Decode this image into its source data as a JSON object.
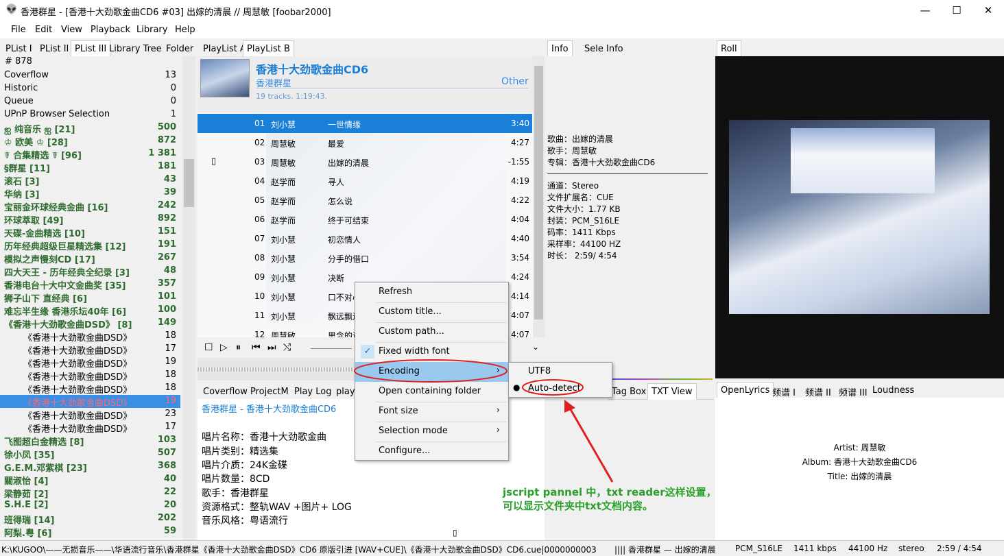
{
  "window": {
    "title": "香港群星 - [香港十大劲歌金曲CD6 #03] 出嫁的清晨 // 周慧敏  [foobar2000]",
    "minimize": "—",
    "maximize": "☐",
    "close": "✕"
  },
  "menu": [
    "File",
    "Edit",
    "View",
    "Playback",
    "Library",
    "Help"
  ],
  "left_tabs": [
    "PList I",
    "PList II",
    "PList III",
    "Library Tree",
    "Folder"
  ],
  "left_count": "# 878",
  "left_list": [
    {
      "name": "Coverflow",
      "count": "13",
      "type": "plain"
    },
    {
      "name": "Historic",
      "count": "0",
      "type": "plain"
    },
    {
      "name": "Queue",
      "count": "0",
      "type": "plain"
    },
    {
      "name": "UPnP Browser Selection",
      "count": "1",
      "type": "plain"
    },
    {
      "name": "ஐ 纯音乐 ஐ [21]",
      "count": "500",
      "type": "grp"
    },
    {
      "name": "♔ 欧美 ♔ [28]",
      "count": "872",
      "type": "grp"
    },
    {
      "name": "☤ 合集精选 ☤ [96]",
      "count": "1 381",
      "type": "grp"
    },
    {
      "name": "§群星 [11]",
      "count": "181",
      "type": "grp"
    },
    {
      "name": "滚石 [3]",
      "count": "43",
      "type": "grp"
    },
    {
      "name": "华纳 [3]",
      "count": "39",
      "type": "grp"
    },
    {
      "name": "宝丽金环球经典金曲 [16]",
      "count": "242",
      "type": "grp"
    },
    {
      "name": "环球萃取 [49]",
      "count": "892",
      "type": "grp"
    },
    {
      "name": "天碟-金曲精选 [10]",
      "count": "151",
      "type": "grp"
    },
    {
      "name": "历年经典超级巨星精选集 [12]",
      "count": "191",
      "type": "grp"
    },
    {
      "name": "模拟之声慢刻CD [17]",
      "count": "267",
      "type": "grp"
    },
    {
      "name": "四大天王 - 历年经典全纪录 [3]",
      "count": "48",
      "type": "grp"
    },
    {
      "name": "香港电台十大中文金曲奖 [35]",
      "count": "357",
      "type": "grp"
    },
    {
      "name": "狮子山下 直经典 [6]",
      "count": "101",
      "type": "grp"
    },
    {
      "name": "难忘半生缘 香港乐坛40年 [6]",
      "count": "100",
      "type": "grp"
    },
    {
      "name": "《香港十大劲歌金曲DSD》 [8]",
      "count": "149",
      "type": "grp"
    },
    {
      "name": "《香港十大劲歌金曲DSD》",
      "count": "18",
      "type": "sub"
    },
    {
      "name": "《香港十大劲歌金曲DSD》",
      "count": "17",
      "type": "sub"
    },
    {
      "name": "《香港十大劲歌金曲DSD》",
      "count": "19",
      "type": "sub"
    },
    {
      "name": "《香港十大劲歌金曲DSD》",
      "count": "18",
      "type": "sub"
    },
    {
      "name": "《香港十大劲歌金曲DSD》",
      "count": "18",
      "type": "sub"
    },
    {
      "name": "《香港十大劲歌金曲DSD》",
      "count": "19",
      "type": "sub sel"
    },
    {
      "name": "《香港十大劲歌金曲DSD》",
      "count": "23",
      "type": "sub"
    },
    {
      "name": "《香港十大劲歌金曲DSD》",
      "count": "17",
      "type": "sub"
    },
    {
      "name": "飞图超白金精选 [8]",
      "count": "103",
      "type": "grp"
    },
    {
      "name": "徐小凤 [35]",
      "count": "507",
      "type": "grp"
    },
    {
      "name": "G.E.M.邓紫棋 [23]",
      "count": "368",
      "type": "grp"
    },
    {
      "name": "關淑怡 [4]",
      "count": "40",
      "type": "grp"
    },
    {
      "name": "梁静茹 [2]",
      "count": "22",
      "type": "grp"
    },
    {
      "name": "S.H.E [2]",
      "count": "20",
      "type": "grp"
    },
    {
      "name": "班得瑞 [14]",
      "count": "202",
      "type": "grp"
    },
    {
      "name": "阿梨.粤 [6]",
      "count": "59",
      "type": "grp"
    }
  ],
  "playlist_tabs": [
    "PlayList A",
    "PlayList B"
  ],
  "album": {
    "title": "香港十大劲歌金曲CD6",
    "artist": "香港群星",
    "genre": "Other",
    "summary": "19 tracks. 1:19:43."
  },
  "tracks": [
    {
      "no": "01",
      "artist": "刘小慧",
      "title": "一世情缘",
      "time": "3:40"
    },
    {
      "no": "02",
      "artist": "周慧敏",
      "title": "最爱",
      "time": "4:27"
    },
    {
      "no": "03",
      "artist": "周慧敏",
      "title": "出嫁的清晨",
      "time": "-1:55"
    },
    {
      "no": "04",
      "artist": "赵学而",
      "title": "寻人",
      "time": "4:19"
    },
    {
      "no": "05",
      "artist": "赵学而",
      "title": "怎么说",
      "time": "4:22"
    },
    {
      "no": "06",
      "artist": "赵学而",
      "title": "终于可结束",
      "time": "4:04"
    },
    {
      "no": "07",
      "artist": "刘小慧",
      "title": "初恋情人",
      "time": "4:40"
    },
    {
      "no": "08",
      "artist": "刘小慧",
      "title": "分手的借口",
      "time": "3:54"
    },
    {
      "no": "09",
      "artist": "刘小慧",
      "title": "决断",
      "time": "4:24"
    },
    {
      "no": "10",
      "artist": "刘小慧",
      "title": "口不对心",
      "time": "4:14"
    },
    {
      "no": "11",
      "artist": "刘小慧",
      "title": "飘远飘近",
      "time": "4:07"
    },
    {
      "no": "12",
      "artist": "周慧敏",
      "title": "思念的话",
      "time": "4:07"
    }
  ],
  "info_tabs": [
    "Info",
    "Sele Info"
  ],
  "info": {
    "song": "歌曲：出嫁的清晨",
    "singer": "歌手：周慧敏",
    "album": "专辑：香港十大劲歌金曲CD6",
    "channel": "通道：Stereo",
    "ext": "文件扩展名：CUE",
    "size": "文件大小：1.77 KB",
    "codec": "封装：PCM_S16LE",
    "bitrate": "码率：1411 Kbps",
    "samplerate": "采样率：44100 HZ",
    "duration": "时长：  2:59/ 4:54"
  },
  "roll_tab": "Roll",
  "context_menu": {
    "refresh": "Refresh",
    "custom_title": "Custom title...",
    "custom_path": "Custom path...",
    "fixed_width": "Fixed width font",
    "encoding": "Encoding",
    "open_folder": "Open containing folder",
    "font_size": "Font size",
    "selection_mode": "Selection mode",
    "configure": "Configure..."
  },
  "submenu": {
    "utf8": "UTF8",
    "auto": "Auto-detect"
  },
  "bottom_tabs": [
    "Coverflow",
    "ProjectM",
    "Play Log",
    "playl",
    "Tag Box",
    "TXT View"
  ],
  "txt_view": {
    "header": "香港群星 - 香港十大劲歌金曲CD6",
    "lines": [
      "唱片名称：香港十大劲歌金曲",
      "唱片类别：精选集",
      "唱片介质：24K金碟",
      "唱片数量：8CD",
      "歌手：香港群星",
      "资源格式：整轨WAV +图片+ LOG",
      "音乐风格：粤语流行"
    ]
  },
  "lyric_tabs": [
    "OpenLyrics",
    "频谱 I",
    "频谱 II",
    "频谱 III",
    "Loudness"
  ],
  "lyrics": {
    "artist": "Artist: 周慧敏",
    "album": "Album: 香港十大劲歌金曲CD6",
    "title": "Title: 出嫁的清晨"
  },
  "annotation": {
    "line1": "jscript pannel 中，txt reader这样设置，",
    "line2": "可以显示文件夹中txt文档内容。"
  },
  "status": {
    "path": "K:\\KUGOO\\——无损音乐——\\华语流行音乐\\香港群星《香港十大劲歌金曲DSD》CD6 原版引进 [WAV+CUE]\\《香港十大劲歌金曲DSD》CD6.cue|0000000003",
    "nowplaying": "||||  香港群星  —  出嫁的清晨",
    "codec": "PCM_S16LE",
    "bitrate": "1411 kbps",
    "rate": "44100 Hz",
    "ch": "stereo",
    "time": "2:59 / 4:54"
  },
  "colors": {
    "accent": "#1a7fd6",
    "group_green": "#2e6b2e",
    "annotation_green": "#2aa02a",
    "circle_red": "#e02020"
  }
}
